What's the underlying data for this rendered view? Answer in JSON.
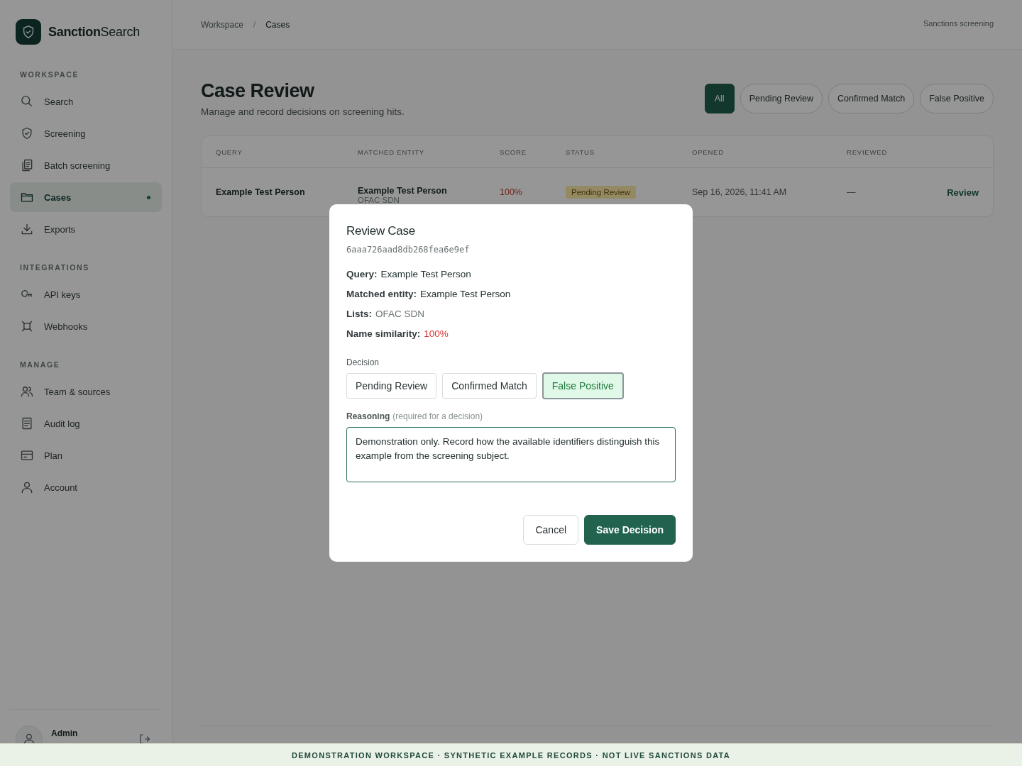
{
  "brand": {
    "name": "**Sanction**Search"
  },
  "sidebar": {
    "sections": [
      {
        "heading": "WORKSPACE",
        "items": [
          {
            "label": "Search",
            "selected": false
          },
          {
            "label": "Screening",
            "selected": false
          },
          {
            "label": "Batch screening",
            "selected": false
          },
          {
            "label": "Cases",
            "selected": true
          },
          {
            "label": "Exports",
            "selected": false
          }
        ]
      },
      {
        "heading": "INTEGRATIONS",
        "items": [
          {
            "label": "API keys",
            "selected": false
          },
          {
            "label": "Webhooks",
            "selected": false
          }
        ]
      },
      {
        "heading": "MANAGE",
        "items": [
          {
            "label": "Team & sources",
            "selected": false
          },
          {
            "label": "Audit log",
            "selected": false
          },
          {
            "label": "Plan",
            "selected": false
          },
          {
            "label": "Account",
            "selected": false
          }
        ]
      }
    ],
    "user": {
      "name": "Admin"
    }
  },
  "header": {
    "breadcrumb": [
      {
        "label": "Workspace",
        "current": false
      },
      {
        "label": "Cases",
        "current": true
      }
    ],
    "separator": "/",
    "context": "Sanctions screening"
  },
  "page": {
    "title": "Case Review",
    "subtitle": "Manage and record decisions on screening hits.",
    "filters": [
      {
        "label": "All",
        "selected": true
      },
      {
        "label": "Pending Review",
        "selected": false
      },
      {
        "label": "Confirmed Match",
        "selected": false
      },
      {
        "label": "False Positive",
        "selected": false
      }
    ]
  },
  "table": {
    "columns": [
      "QUERY",
      "MATCHED ENTITY",
      "SCORE",
      "STATUS",
      "OPENED",
      "REVIEWED"
    ],
    "rows": [
      {
        "query": "Example Test Person",
        "entity": "Example Test Person",
        "entity_list": "OFAC SDN",
        "score": "100%",
        "status": "Pending Review",
        "opened": "Sep 16, 2026, 11:41 AM",
        "reviewed": "—",
        "action": "Review"
      }
    ]
  },
  "modal": {
    "title": "Review Case",
    "case_id": "6aaa726aad8db268fea6e9ef",
    "fields": [
      {
        "label": "Query:",
        "value": "Example Test Person",
        "kind": "plain"
      },
      {
        "label": "Matched entity:",
        "value": "Example Test Person",
        "kind": "plain"
      },
      {
        "label": "Lists:",
        "value": "OFAC SDN",
        "kind": "muted"
      },
      {
        "label": "Name similarity:",
        "value": "100%",
        "kind": "alert"
      }
    ],
    "decision_label": "Decision",
    "decisions": [
      {
        "label": "Pending Review",
        "selected": false
      },
      {
        "label": "Confirmed Match",
        "selected": false
      },
      {
        "label": "False Positive",
        "selected": true
      }
    ],
    "reasoning_label": "Reasoning",
    "reasoning_hint": "(required for a decision)",
    "reasoning_value": "Demonstration only. Record how the available identifiers distinguish this example from the screening subject.",
    "buttons": [
      {
        "label": "Cancel",
        "kind": "secondary"
      },
      {
        "label": "Save Decision",
        "kind": "primary"
      }
    ]
  },
  "banner": "DEMONSTRATION WORKSPACE · SYNTHETIC EXAMPLE RECORDS · NOT LIVE SANCTIONS DATA"
}
